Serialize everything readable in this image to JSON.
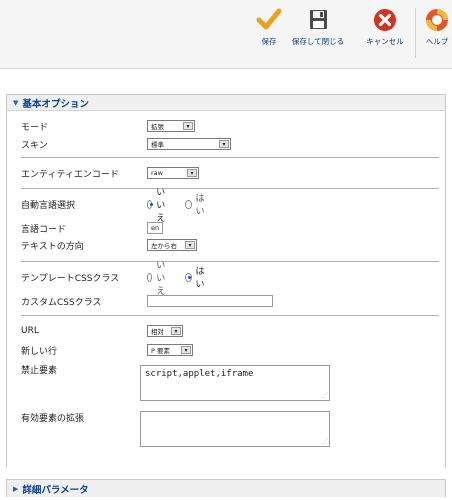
{
  "toolbar": {
    "save_label": "保存",
    "save_close_label": "保存して閉じる",
    "cancel_label": "キャンセル",
    "help_label": "ヘルプ"
  },
  "panel": {
    "title": "基本オプション",
    "mode": {
      "label": "モード",
      "value": "拡張"
    },
    "skin": {
      "label": "スキン",
      "value": "標準"
    },
    "entity_encode": {
      "label": "エンティティエンコード",
      "value": "raw"
    },
    "auto_lang": {
      "label": "自動言語選択",
      "options": [
        "いいえ",
        "はい"
      ],
      "selected": "いいえ"
    },
    "lang_code": {
      "label": "言語コード",
      "value": "en"
    },
    "text_dir": {
      "label": "テキストの方向",
      "value": "左から右"
    },
    "template_css": {
      "label": "テンプレートCSSクラス",
      "options": [
        "いいえ",
        "はい"
      ],
      "selected": "はい"
    },
    "custom_css": {
      "label": "カスタムCSSクラス",
      "value": ""
    },
    "url": {
      "label": "URL",
      "value": "相対"
    },
    "newline": {
      "label": "新しい行",
      "value": "P 要素"
    },
    "prohibited": {
      "label": "禁止要素",
      "value": "script,applet,iframe"
    },
    "extended": {
      "label": "有効要素の拡張",
      "value": ""
    }
  },
  "advanced": {
    "title": "詳細パラメータ"
  },
  "colors": {
    "link": "#0b3f8f",
    "save_check": "#e8a21c",
    "cancel_red": "#d2321e"
  }
}
